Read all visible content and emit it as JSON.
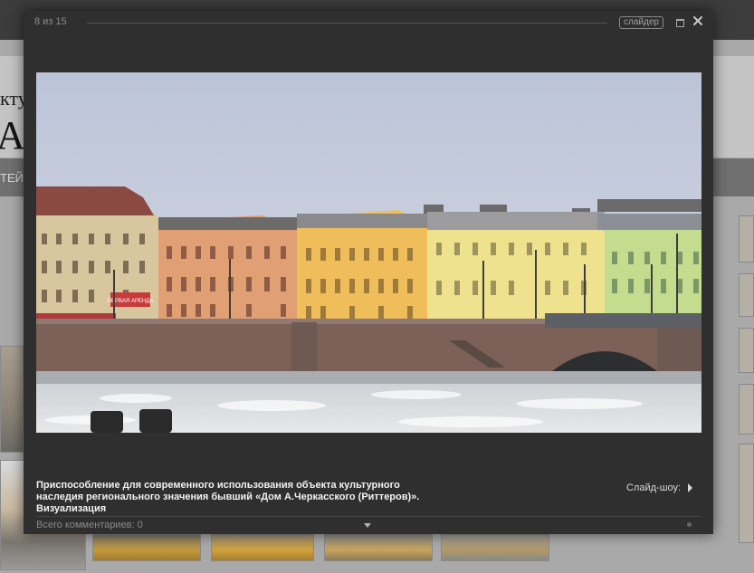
{
  "background": {
    "header_line1": "кту",
    "header_line2": "A",
    "nav_text": "ТЕЙ"
  },
  "modal": {
    "counter": "8 из 15",
    "slider_label": "слайдер",
    "caption": "Приспособление для современного использования объекта культурного наследия регионального значения бывший «Дом А.Черкасского (Риттеров)». Визуализация",
    "slideshow_label": "Слайд-шоу:",
    "comments_label": "Всего комментариев: 0"
  },
  "photo": {
    "sign_text": "ПЕРВАЯ АРЕНДА"
  },
  "colors": {
    "modal_bg": "#2f2f2f",
    "overlay": "#4a4a4a",
    "sky": "#c8cfe0"
  }
}
